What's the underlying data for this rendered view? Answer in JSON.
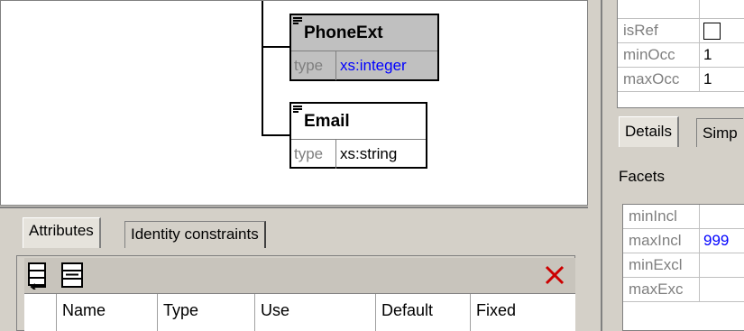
{
  "diagram": {
    "elements": [
      {
        "name": "PhoneExt",
        "type_label": "type",
        "type_value": "xs:integer"
      },
      {
        "name": "Email",
        "type_label": "type",
        "type_value": "xs:string"
      }
    ]
  },
  "lower_panel": {
    "tabs": [
      "Attributes",
      "Identity constraints"
    ],
    "columns": [
      "Name",
      "Type",
      "Use",
      "Default",
      "Fixed"
    ]
  },
  "right_panel": {
    "top_grid": [
      {
        "key": "isRef",
        "value": ""
      },
      {
        "key": "minOcc",
        "value": "1"
      },
      {
        "key": "maxOcc",
        "value": "1"
      }
    ],
    "tabs": [
      "Details",
      "Simp"
    ],
    "facets_title": "Facets",
    "facets": [
      {
        "key": "minIncl",
        "value": ""
      },
      {
        "key": "maxIncl",
        "value": "999"
      },
      {
        "key": "minExcl",
        "value": ""
      },
      {
        "key": "maxExc",
        "value": ""
      }
    ]
  },
  "colors": {
    "link_blue": "#0000ff",
    "delete_red": "#cc0000",
    "element_gray": "#c0c0c0"
  }
}
